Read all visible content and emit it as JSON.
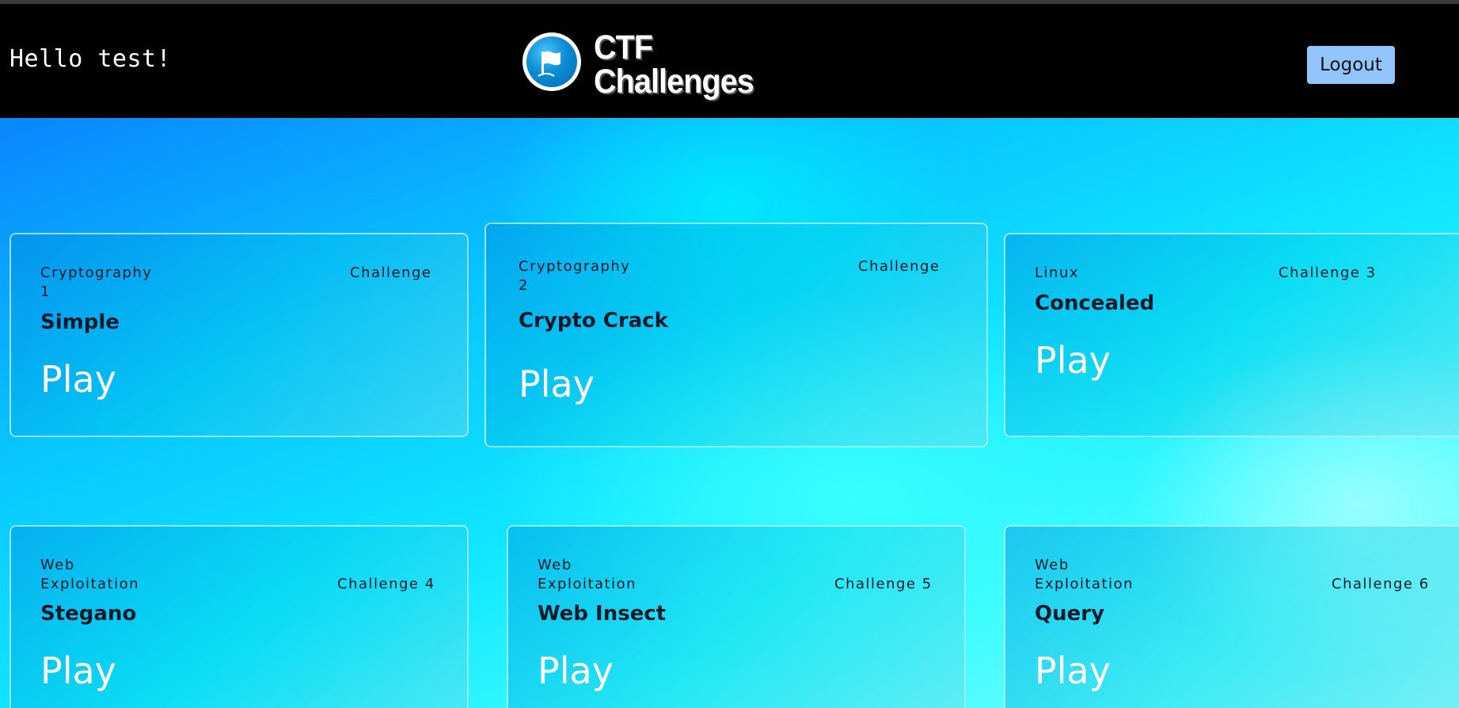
{
  "header": {
    "greeting": "Hello test!",
    "logo_line1": "CTF",
    "logo_line2": "Challenges",
    "logo_icon": "flag-icon",
    "logout_label": "Logout"
  },
  "colors": {
    "header_bg": "#000000",
    "logout_bg": "#93c5fd",
    "card_text": "#0b1a2a",
    "play_text": "#ffffff"
  },
  "challenges": [
    {
      "category": "Cryptography\n1",
      "number": "Challenge",
      "title": "Simple",
      "action": "Play"
    },
    {
      "category": "Cryptography\n2",
      "number": "Challenge",
      "title": "Crypto Crack",
      "action": "Play"
    },
    {
      "category": "Linux",
      "number": "Challenge 3",
      "title": "Concealed",
      "action": "Play"
    },
    {
      "category": "Web\nExploitation",
      "number": "Challenge 4",
      "title": "Stegano",
      "action": "Play"
    },
    {
      "category": "Web\nExploitation",
      "number": "Challenge 5",
      "title": "Web Insect",
      "action": "Play"
    },
    {
      "category": "Web\nExploitation",
      "number": "Challenge 6",
      "title": "Query",
      "action": "Play"
    }
  ]
}
